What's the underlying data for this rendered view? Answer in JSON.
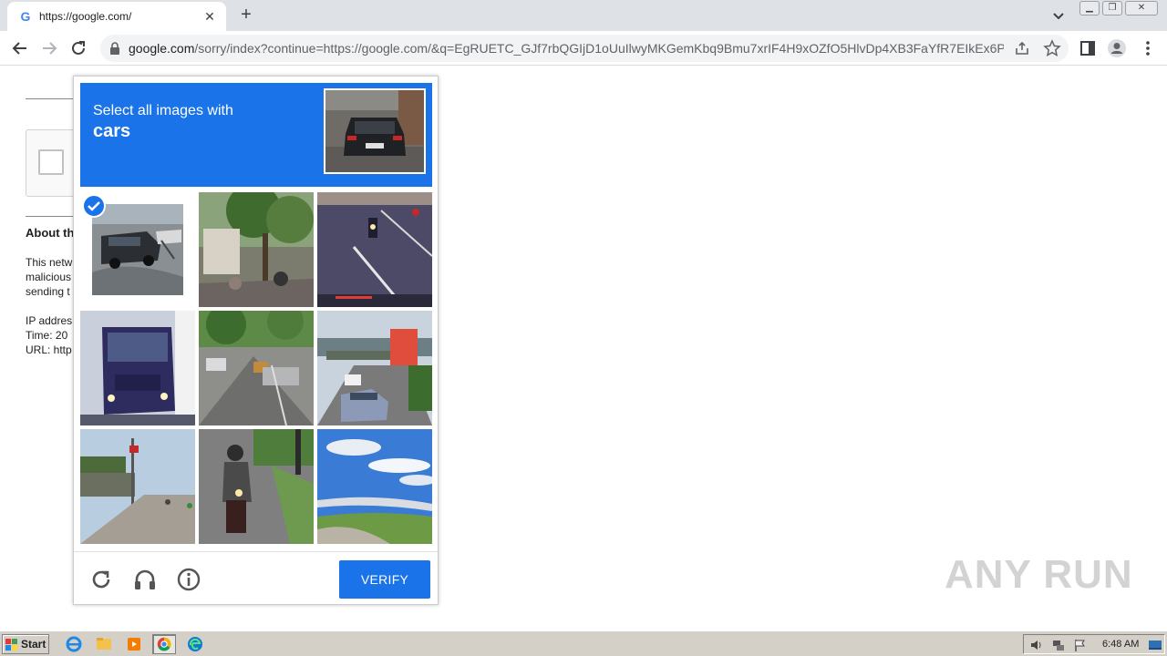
{
  "browser": {
    "tab_title": "https://google.com/",
    "favicon": "G",
    "url_host": "google.com",
    "url_path": "/sorry/index?continue=https://google.com/&q=EgRUETC_GJf7rbQGIjD1oUuIlwyMKGemKbq9Bmu7xrIF4H9xOZfO5HlvDp4XB3FaYfR7EIkEx6P...",
    "icons": [
      "back-icon",
      "forward-icon",
      "reload-icon",
      "lock-icon",
      "share-icon",
      "star-icon",
      "side-panel-icon",
      "profile-icon",
      "menu-icon"
    ]
  },
  "page": {
    "about_heading": "About th",
    "para1_line1": "This netw",
    "para1_line2": "malicious",
    "para1_line3": "sending t",
    "ip_line": "IP addres",
    "time_line": "Time: 20",
    "url_line": "URL: http"
  },
  "captcha": {
    "instruction": "Select all images with",
    "target": "cars",
    "verify_label": "VERIFY",
    "selected_tiles": [
      0
    ],
    "accent_color": "#1a73e8"
  },
  "watermark": "ANY RUN",
  "taskbar": {
    "start_label": "Start",
    "clock": "6:48 AM"
  }
}
